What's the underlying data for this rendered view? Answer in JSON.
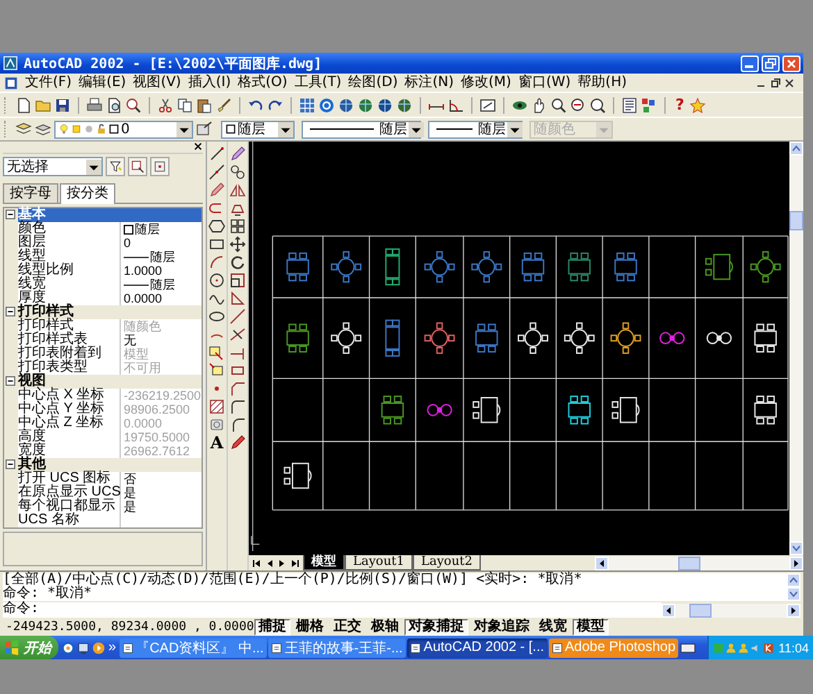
{
  "window": {
    "title": "AutoCAD 2002 - [E:\\2002\\平面图库.dwg]"
  },
  "menu": [
    "文件(F)",
    "编辑(E)",
    "视图(V)",
    "插入(I)",
    "格式(O)",
    "工具(T)",
    "绘图(D)",
    "标注(N)",
    "修改(M)",
    "窗口(W)",
    "帮助(H)"
  ],
  "standard_toolbar": {
    "help_glyph": "?"
  },
  "layer_toolbar": {
    "layer": "0",
    "color_setting": "随层",
    "linetype": "随层",
    "lineweight": "随层",
    "plot_style": "随颜色",
    "plot_style_disabled": true
  },
  "properties": {
    "selection": "无选择",
    "tabs": [
      {
        "label": "按字母",
        "selected": false
      },
      {
        "label": "按分类",
        "selected": true
      }
    ],
    "categories": [
      {
        "name": "基本",
        "selected": true,
        "expanded": true,
        "rows": [
          {
            "name": "颜色",
            "value": "随层",
            "kind": "color",
            "disabled": false
          },
          {
            "name": "图层",
            "value": "0",
            "kind": "text",
            "disabled": false
          },
          {
            "name": "线型",
            "value": "随层",
            "kind": "line",
            "disabled": false
          },
          {
            "name": "线型比例",
            "value": "1.0000",
            "kind": "text",
            "disabled": false
          },
          {
            "name": "线宽",
            "value": "随层",
            "kind": "line",
            "disabled": false
          },
          {
            "name": "厚度",
            "value": "0.0000",
            "kind": "text",
            "disabled": false
          }
        ]
      },
      {
        "name": "打印样式",
        "selected": false,
        "expanded": true,
        "rows": [
          {
            "name": "打印样式",
            "value": "随颜色",
            "kind": "text",
            "disabled": true
          },
          {
            "name": "打印样式表",
            "value": "无",
            "kind": "text",
            "disabled": false
          },
          {
            "name": "打印表附着到",
            "value": "模型",
            "kind": "text",
            "disabled": true
          },
          {
            "name": "打印表类型",
            "value": "不可用",
            "kind": "text",
            "disabled": true
          }
        ]
      },
      {
        "name": "视图",
        "selected": false,
        "expanded": true,
        "rows": [
          {
            "name": "中心点 X 坐标",
            "value": "-236219.2500",
            "kind": "text",
            "disabled": true
          },
          {
            "name": "中心点 Y 坐标",
            "value": "98906.2500",
            "kind": "text",
            "disabled": true
          },
          {
            "name": "中心点 Z 坐标",
            "value": "0.0000",
            "kind": "text",
            "disabled": true
          },
          {
            "name": "高度",
            "value": "19750.5000",
            "kind": "text",
            "disabled": true
          },
          {
            "name": "宽度",
            "value": "26962.7612",
            "kind": "text",
            "disabled": true
          }
        ]
      },
      {
        "name": "其他",
        "selected": false,
        "expanded": true,
        "rows": [
          {
            "name": "打开 UCS 图标",
            "value": "否",
            "kind": "text",
            "disabled": false
          },
          {
            "name": "在原点显示 UCS",
            "value": "是",
            "kind": "text",
            "disabled": false
          },
          {
            "name": "每个视口都显示",
            "value": "是",
            "kind": "text",
            "disabled": false
          },
          {
            "name": "UCS 名称",
            "kind": "text",
            "disabled": false
          }
        ]
      }
    ]
  },
  "draw_toolbar": {
    "text_tool": "A"
  },
  "layout_tabs": [
    {
      "label": "模型",
      "selected": true
    },
    {
      "label": "Layout1",
      "selected": false
    },
    {
      "label": "Layout2",
      "selected": false
    }
  ],
  "command_line": {
    "history": [
      "[全部(A)/中心点(C)/动态(D)/范围(E)/上一个(P)/比例(S)/窗口(W)] <实时>: *取消*",
      "命令: *取消*"
    ],
    "prompt": "命令:"
  },
  "status_bar": {
    "coordinates": "-249423.5000, 89234.0000 , 0.0000",
    "toggles": [
      {
        "label": "捕捉",
        "on": true
      },
      {
        "label": "栅格",
        "on": false
      },
      {
        "label": "正交",
        "on": false
      },
      {
        "label": "极轴",
        "on": false
      },
      {
        "label": "对象捕捉",
        "on": true
      },
      {
        "label": "对象追踪",
        "on": false
      },
      {
        "label": "线宽",
        "on": false
      },
      {
        "label": "模型",
        "on": true
      }
    ]
  },
  "taskbar": {
    "start": "开始",
    "overflow": "»",
    "clock": "11:04",
    "tasks": [
      {
        "label": "『CAD资料区』 中...",
        "selected": false,
        "flashing": false
      },
      {
        "label": "王菲的故事-王菲-...",
        "selected": false,
        "flashing": false
      },
      {
        "label": "AutoCAD 2002 - [...",
        "selected": true,
        "flashing": false
      },
      {
        "label": "Adobe Photoshop",
        "selected": false,
        "flashing": true
      }
    ]
  }
}
